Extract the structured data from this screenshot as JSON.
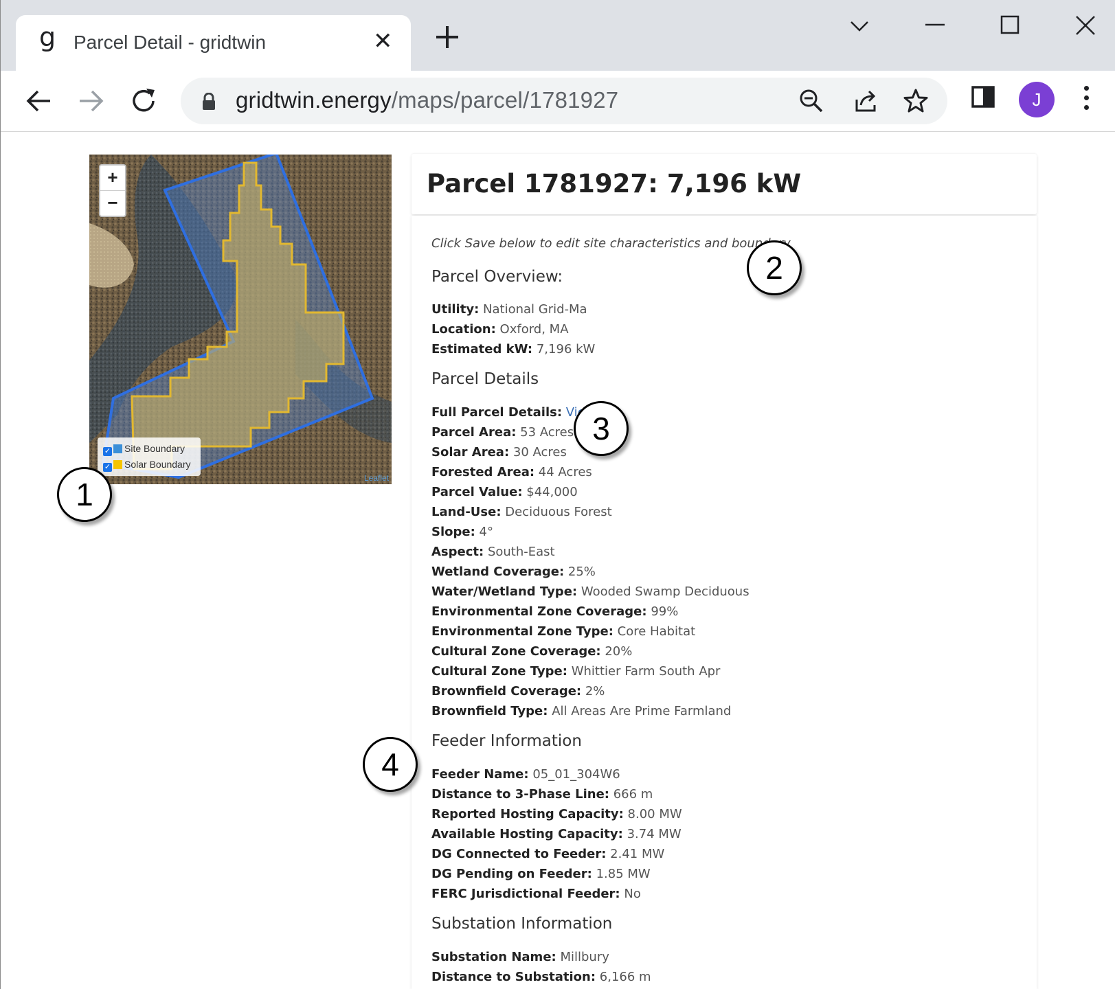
{
  "browser": {
    "tab_favicon": "g",
    "tab_title": "Parcel Detail - gridtwin",
    "tab_close": "✕",
    "url_host": "gridtwin.energy",
    "url_path": "/maps/parcel/1781927",
    "profile_initial": "J",
    "icons": [
      "back-icon",
      "forward-icon",
      "reload-icon",
      "lock-icon",
      "zoom-out-icon",
      "share-icon",
      "star-icon",
      "side-panel-icon",
      "kebab-menu-icon",
      "tab-search-icon",
      "minimize-icon",
      "maximize-icon",
      "close-icon"
    ]
  },
  "map": {
    "zoom_in": "+",
    "zoom_out": "−",
    "legend": [
      {
        "label": "Site Boundary",
        "color": "#3b8fd8",
        "checked": true
      },
      {
        "label": "Solar Boundary",
        "color": "#f5c400",
        "checked": true
      }
    ],
    "attribution": "Leaflet",
    "colors": {
      "site_boundary": "#2f6fe0",
      "solar_boundary": "#e2b830"
    }
  },
  "panel": {
    "title": "Parcel 1781927: 7,196 kW",
    "hint": "Click Save below to edit site characteristics and boundary",
    "overview": {
      "title": "Parcel Overview:",
      "rows": [
        {
          "k": "Utility:",
          "v": "National Grid-Ma"
        },
        {
          "k": "Location:",
          "v": "Oxford, MA"
        },
        {
          "k": "Estimated kW:",
          "v": "7,196 kW"
        }
      ]
    },
    "details": {
      "title": "Parcel Details",
      "full_label": "Full Parcel Details:",
      "full_link": "View",
      "rows": [
        {
          "k": "Parcel Area:",
          "v": "53 Acres"
        },
        {
          "k": "Solar Area:",
          "v": "30 Acres"
        },
        {
          "k": "Forested Area:",
          "v": "44 Acres"
        },
        {
          "k": "Parcel Value:",
          "v": "$44,000"
        },
        {
          "k": "Land-Use:",
          "v": "Deciduous Forest"
        },
        {
          "k": "Slope:",
          "v": "4°"
        },
        {
          "k": "Aspect:",
          "v": "South-East"
        },
        {
          "k": "Wetland Coverage:",
          "v": "25%"
        },
        {
          "k": "Water/Wetland Type:",
          "v": "Wooded Swamp Deciduous"
        },
        {
          "k": "Environmental Zone Coverage:",
          "v": "99%"
        },
        {
          "k": "Environmental Zone Type:",
          "v": "Core Habitat"
        },
        {
          "k": "Cultural Zone Coverage:",
          "v": "20%"
        },
        {
          "k": "Cultural Zone Type:",
          "v": "Whittier Farm South Apr"
        },
        {
          "k": "Brownfield Coverage:",
          "v": "2%"
        },
        {
          "k": "Brownfield Type:",
          "v": "All Areas Are Prime Farmland"
        }
      ]
    },
    "feeder": {
      "title": "Feeder Information",
      "rows": [
        {
          "k": "Feeder Name:",
          "v": "05_01_304W6"
        },
        {
          "k": "Distance to 3-Phase Line:",
          "v": "666 m"
        },
        {
          "k": "Reported Hosting Capacity:",
          "v": "8.00 MW"
        },
        {
          "k": "Available Hosting Capacity:",
          "v": "3.74 MW"
        },
        {
          "k": "DG Connected to Feeder:",
          "v": "2.41 MW"
        },
        {
          "k": "DG Pending on Feeder:",
          "v": "1.85 MW"
        },
        {
          "k": "FERC Jurisdictional Feeder:",
          "v": "No"
        }
      ]
    },
    "substation": {
      "title": "Substation Information",
      "rows": [
        {
          "k": "Substation Name:",
          "v": "Millbury"
        },
        {
          "k": "Distance to Substation:",
          "v": "6,166 m"
        }
      ]
    }
  },
  "callouts": [
    "1",
    "2",
    "3",
    "4"
  ]
}
